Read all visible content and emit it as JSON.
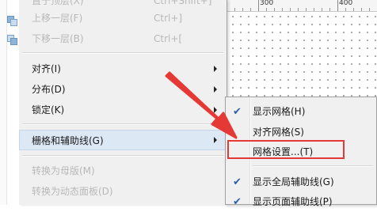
{
  "ruler": {
    "marks": [
      "300",
      "400"
    ]
  },
  "menu": {
    "items": [
      {
        "label": "置于顶层(X)",
        "shortcut": "Ctrl+Shift+]",
        "disabled": true
      },
      {
        "label": "上移一层(F)",
        "shortcut": "Ctrl+]",
        "disabled": true
      },
      {
        "label": "下移一层(B)",
        "shortcut": "Ctrl+[",
        "disabled": true
      },
      {
        "label": "对齐(I)",
        "submenu": true
      },
      {
        "label": "分布(D)",
        "submenu": true
      },
      {
        "label": "锁定(K)",
        "submenu": true
      },
      {
        "label": "栅格和辅助线(G)",
        "submenu": true,
        "highlighted": true
      },
      {
        "label": "转换为母版(M)",
        "disabled": true
      },
      {
        "label": "转换为动态面板(D)",
        "disabled": true
      }
    ]
  },
  "submenu": {
    "items": [
      {
        "label": "显示网格(H)",
        "checked": true
      },
      {
        "label": "对齐网格(S)",
        "checked": false
      },
      {
        "label": "网格设置...(T)",
        "checked": false,
        "annotated": true
      },
      {
        "label": "显示全局辅助线(G)",
        "checked": true
      },
      {
        "label": "显示页面辅助线(P)",
        "checked": true
      }
    ]
  },
  "colors": {
    "annotation": "#e53935",
    "menu_bg": "#f0f0f0",
    "highlight": "#dde8f5"
  }
}
